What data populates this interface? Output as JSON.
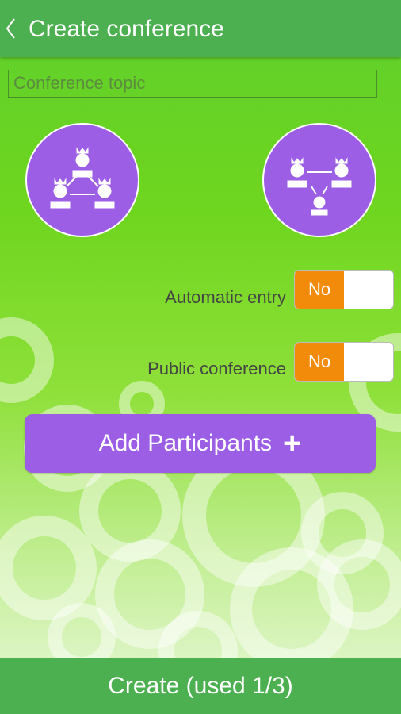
{
  "header": {
    "title": "Create conference",
    "back_icon": "chevron-left-icon"
  },
  "topic": {
    "placeholder": "Conference topic",
    "value": ""
  },
  "modes": [
    {
      "icon": "group-conference-icon"
    },
    {
      "icon": "broadcast-conference-icon"
    }
  ],
  "settings": {
    "automatic_entry": {
      "label": "Automatic entry",
      "value": "No"
    },
    "public_conference": {
      "label": "Public conference",
      "value": "No"
    }
  },
  "add_button": {
    "label": "Add Participants",
    "icon": "plus-icon"
  },
  "footer": {
    "create_label": "Create (used 1/3)"
  },
  "colors": {
    "accent": "#9d5ee6",
    "bar": "#4caf50",
    "toggle_on": "#f38b0a"
  }
}
